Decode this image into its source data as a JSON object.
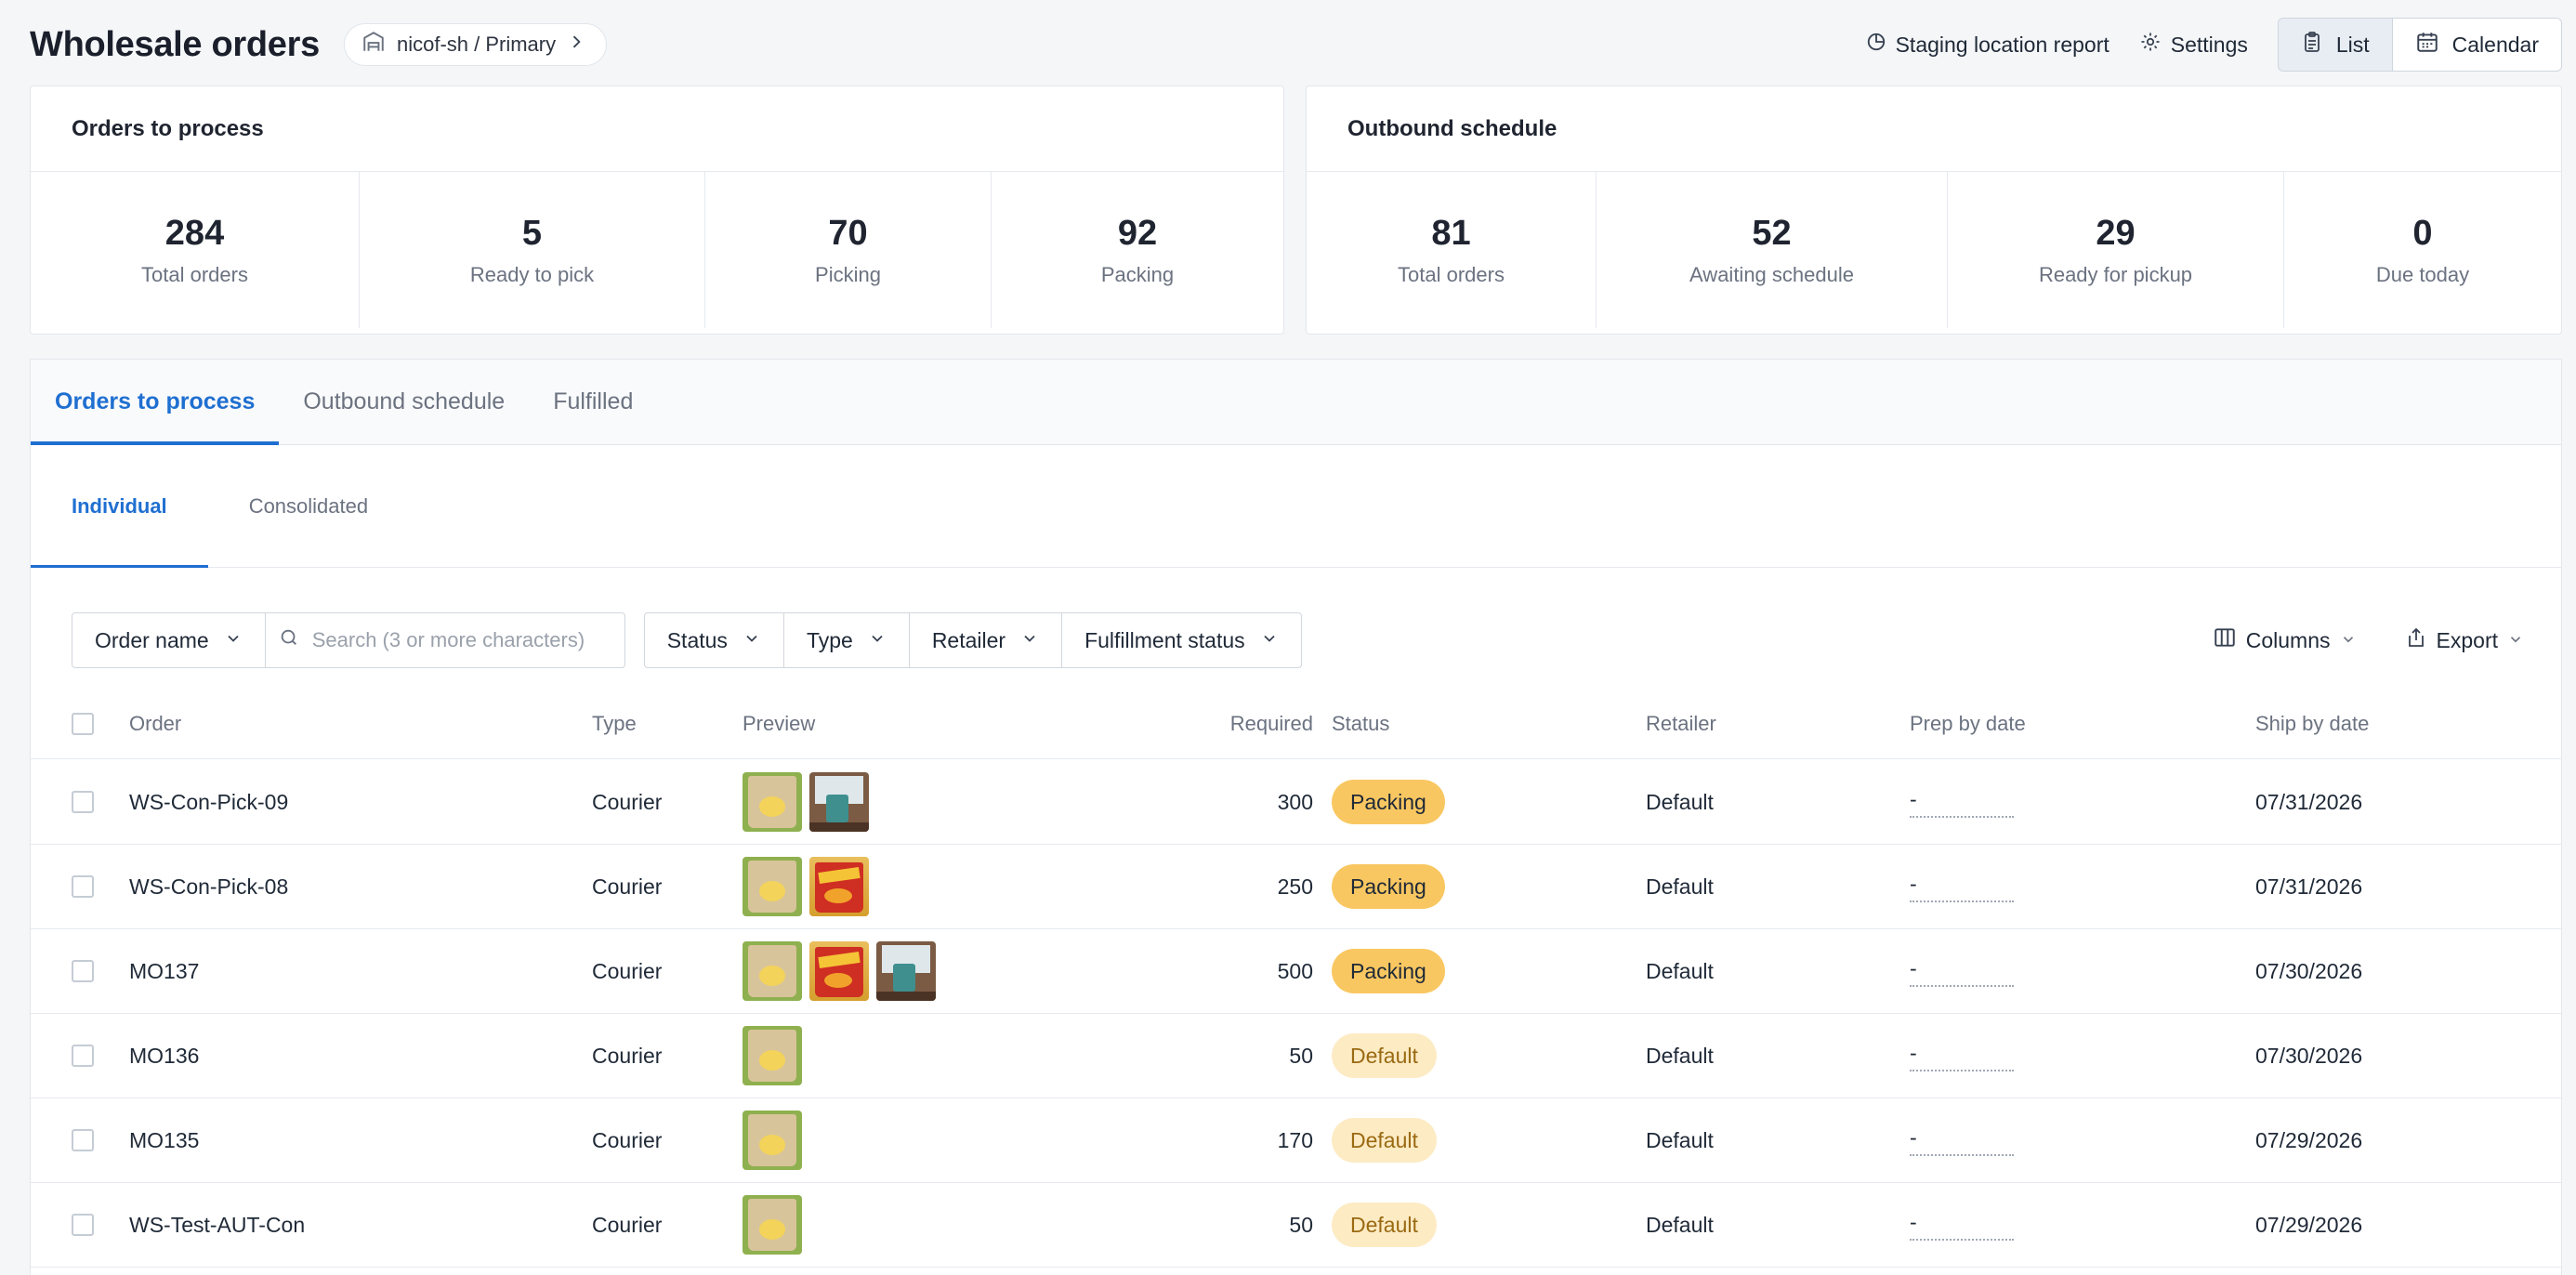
{
  "header": {
    "title": "Wholesale orders",
    "location": "nicof-sh / Primary",
    "staging_report": "Staging location report",
    "settings": "Settings",
    "view_list": "List",
    "view_calendar": "Calendar"
  },
  "orders_card": {
    "title": "Orders to process",
    "stats": [
      {
        "value": "284",
        "label": "Total orders"
      },
      {
        "value": "5",
        "label": "Ready to pick"
      },
      {
        "value": "70",
        "label": "Picking"
      },
      {
        "value": "92",
        "label": "Packing"
      }
    ]
  },
  "outbound_card": {
    "title": "Outbound schedule",
    "stats": [
      {
        "value": "81",
        "label": "Total orders"
      },
      {
        "value": "52",
        "label": "Awaiting schedule"
      },
      {
        "value": "29",
        "label": "Ready for pickup"
      },
      {
        "value": "0",
        "label": "Due today"
      }
    ]
  },
  "tabs": [
    "Orders to process",
    "Outbound schedule",
    "Fulfilled"
  ],
  "subtabs": [
    "Individual",
    "Consolidated"
  ],
  "filters": {
    "order_name": "Order name",
    "search_placeholder": "Search (3 or more characters)",
    "status": "Status",
    "type": "Type",
    "retailer": "Retailer",
    "fulfillment_status": "Fulfillment status",
    "columns": "Columns",
    "export": "Export"
  },
  "table": {
    "headers": {
      "order": "Order",
      "type": "Type",
      "preview": "Preview",
      "required": "Required",
      "status": "Status",
      "retailer": "Retailer",
      "prep_by": "Prep by date",
      "ship_by": "Ship by date"
    },
    "rows": [
      {
        "order": "WS-Con-Pick-09",
        "type": "Courier",
        "preview": [
          "crunchy-bunch",
          "mug"
        ],
        "required": "300",
        "status": "Packing",
        "status_kind": "packing",
        "retailer": "Default",
        "prep_by": "-",
        "ship_by": "07/31/2026"
      },
      {
        "order": "WS-Con-Pick-08",
        "type": "Courier",
        "preview": [
          "crunchy-bunch",
          "cheese-crunchies"
        ],
        "required": "250",
        "status": "Packing",
        "status_kind": "packing",
        "retailer": "Default",
        "prep_by": "-",
        "ship_by": "07/31/2026"
      },
      {
        "order": "MO137",
        "type": "Courier",
        "preview": [
          "crunchy-bunch",
          "cheese-crunchies",
          "mug"
        ],
        "required": "500",
        "status": "Packing",
        "status_kind": "packing",
        "retailer": "Default",
        "prep_by": "-",
        "ship_by": "07/30/2026"
      },
      {
        "order": "MO136",
        "type": "Courier",
        "preview": [
          "crunchy-bunch"
        ],
        "required": "50",
        "status": "Default",
        "status_kind": "default",
        "retailer": "Default",
        "prep_by": "-",
        "ship_by": "07/30/2026"
      },
      {
        "order": "MO135",
        "type": "Courier",
        "preview": [
          "crunchy-bunch"
        ],
        "required": "170",
        "status": "Default",
        "status_kind": "default",
        "retailer": "Default",
        "prep_by": "-",
        "ship_by": "07/29/2026"
      },
      {
        "order": "WS-Test-AUT-Con",
        "type": "Courier",
        "preview": [
          "crunchy-bunch"
        ],
        "required": "50",
        "status": "Default",
        "status_kind": "default",
        "retailer": "Default",
        "prep_by": "-",
        "ship_by": "07/29/2026"
      }
    ]
  },
  "colors": {
    "accent": "#1f6fd1",
    "packing_badge": "#f9c761",
    "default_badge": "#fdebc4"
  }
}
